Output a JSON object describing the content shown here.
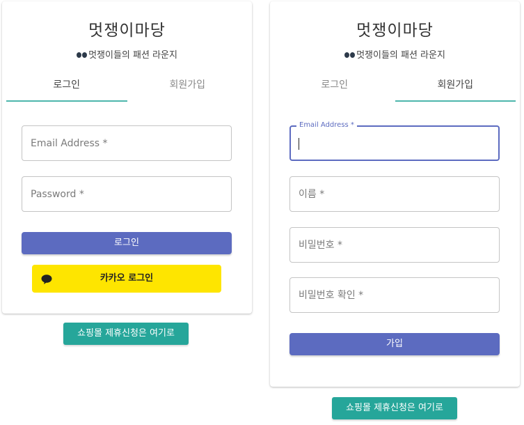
{
  "brand": {
    "title": "멋쟁이마당",
    "subtitle": "멋쟁이들의 패션 라운지",
    "subtitle_icon": "glasses-icon"
  },
  "login_card": {
    "tabs": [
      {
        "label": "로그인",
        "active": true
      },
      {
        "label": "회원가입",
        "active": false
      }
    ],
    "email_placeholder": "Email Address *",
    "password_placeholder": "Password *",
    "login_button": "로그인",
    "kakao_button": "카카오 로그인",
    "kakao_icon": "speech-bubble-icon"
  },
  "signup_card": {
    "tabs": [
      {
        "label": "로그인",
        "active": false
      },
      {
        "label": "회원가입",
        "active": true
      }
    ],
    "email_label": "Email Address *",
    "email_value": "",
    "name_placeholder": "이름 *",
    "password_placeholder": "비밀번호 *",
    "password_confirm_placeholder": "비밀번호 확인 *",
    "signup_button": "가입"
  },
  "partner_button": "쇼핑몰 제휴신청은 여기로",
  "colors": {
    "primary": "#5c6bc0",
    "accent_teal": "#4db6ac",
    "partner_green": "#26a69a",
    "kakao_yellow": "#fee500"
  }
}
